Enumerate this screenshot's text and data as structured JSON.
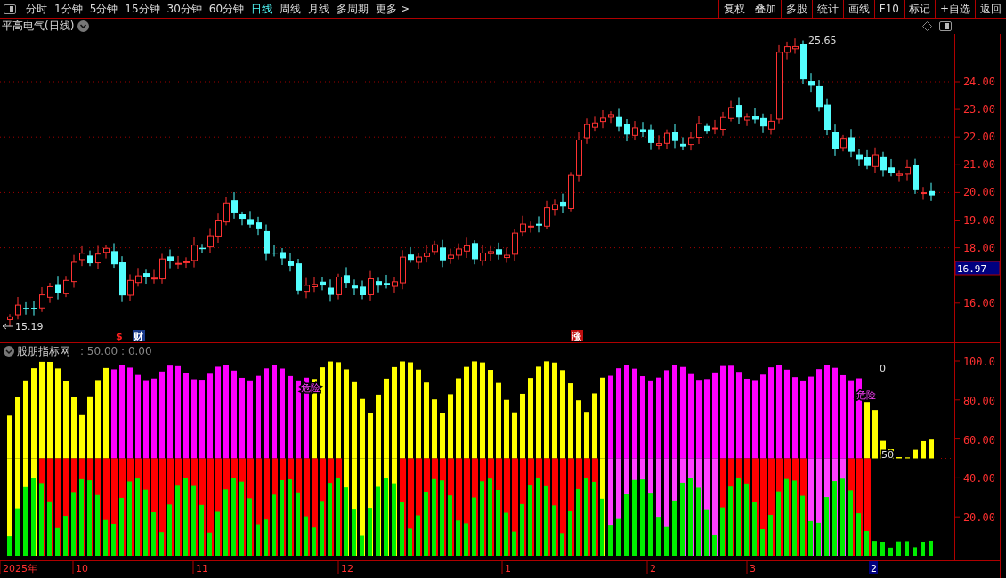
{
  "toolbar": {
    "periods": [
      {
        "label": "分时",
        "selected": false
      },
      {
        "label": "1分钟",
        "selected": false
      },
      {
        "label": "5分钟",
        "selected": false
      },
      {
        "label": "15分钟",
        "selected": false
      },
      {
        "label": "30分钟",
        "selected": false
      },
      {
        "label": "60分钟",
        "selected": false
      },
      {
        "label": "日线",
        "selected": true
      },
      {
        "label": "周线",
        "selected": false
      },
      {
        "label": "月线",
        "selected": false
      },
      {
        "label": "多周期",
        "selected": false
      },
      {
        "label": "更多 >",
        "selected": false
      }
    ],
    "buttons": [
      "复权",
      "叠加",
      "多股",
      "统计",
      "画线",
      "F10",
      "标记",
      "+自选",
      "返回"
    ]
  },
  "chart_title": "平高电气(日线)",
  "price_axis": [
    "24.00",
    "23.00",
    "22.00",
    "21.00",
    "20.00",
    "19.00",
    "18.00",
    "16.00"
  ],
  "current_price": "16.97",
  "high_label": "25.65",
  "low_label": "15.19",
  "markers": [
    {
      "text": "$",
      "kind": "dividend"
    },
    {
      "text": "财",
      "kind": "finance"
    },
    {
      "text": "涨",
      "kind": "limit"
    }
  ],
  "indicator": {
    "name": "股朋指标网",
    "values": ": 50.00 : 0.00",
    "axis": [
      "100.0",
      "80.00",
      "60.00",
      "40.00",
      "20.00"
    ],
    "labels": [
      {
        "text": "0",
        "kind": "value"
      },
      {
        "text": "50",
        "kind": "value"
      },
      {
        "text": "危险",
        "kind": "warning"
      },
      {
        "text": "危险",
        "kind": "warning"
      }
    ]
  },
  "date_axis": [
    {
      "label": "2025年",
      "selected": false
    },
    {
      "label": "10",
      "selected": false
    },
    {
      "label": "11",
      "selected": false
    },
    {
      "label": "12",
      "selected": false
    },
    {
      "label": "1",
      "selected": false
    },
    {
      "label": "2",
      "selected": false
    },
    {
      "label": "3",
      "selected": false
    },
    {
      "label": "2",
      "selected": true
    }
  ]
}
